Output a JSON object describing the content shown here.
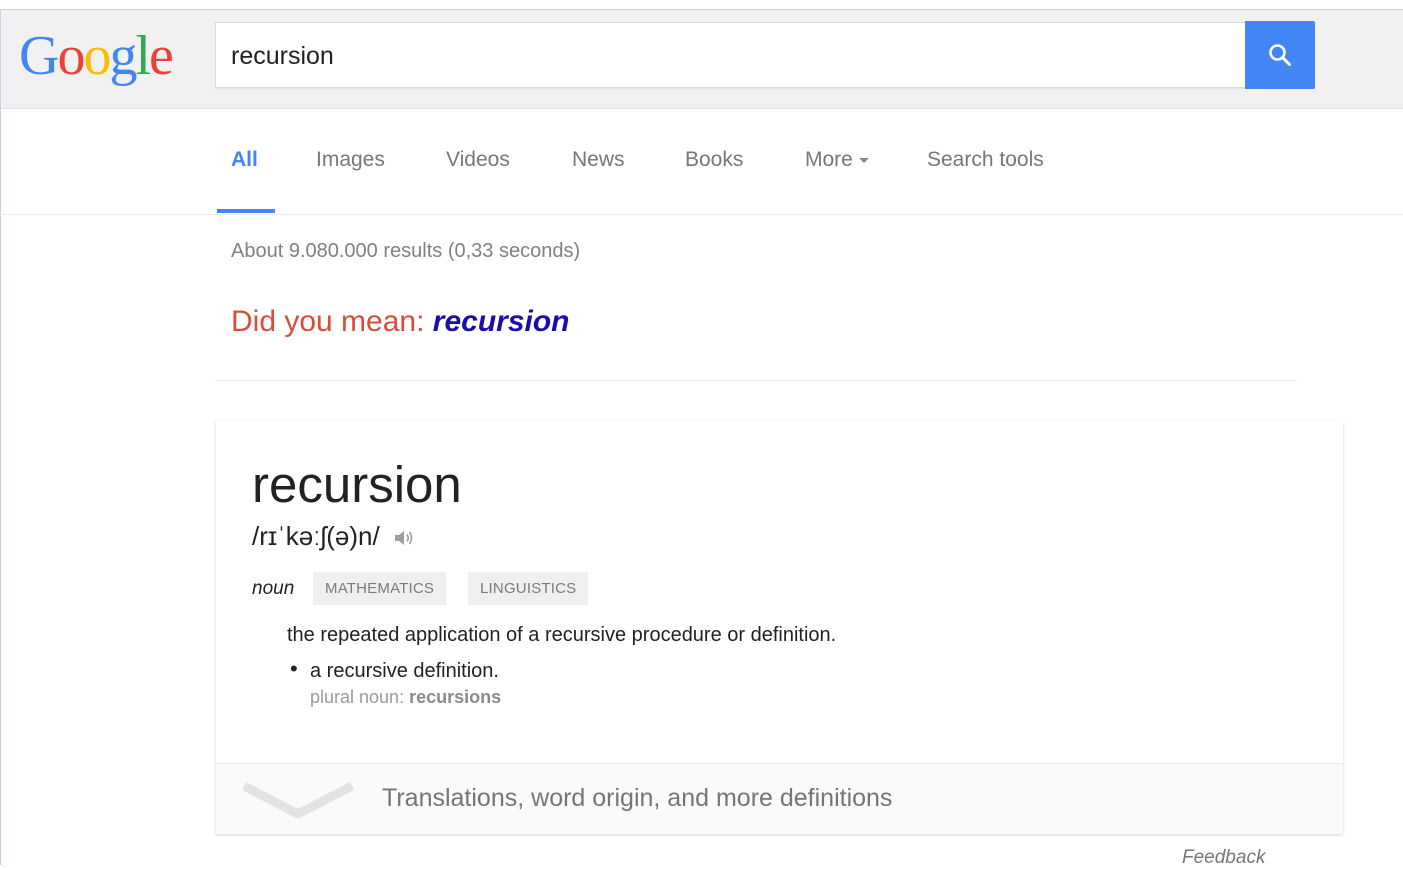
{
  "brand": {
    "logo_letters": [
      {
        "char": "G",
        "color": "#4285f4"
      },
      {
        "char": "o",
        "color": "#ea4335"
      },
      {
        "char": "o",
        "color": "#fbbc05"
      },
      {
        "char": "g",
        "color": "#4285f4"
      },
      {
        "char": "l",
        "color": "#34a853"
      },
      {
        "char": "e",
        "color": "#ea4335"
      }
    ]
  },
  "search": {
    "query": "recursion",
    "button_icon": "search-icon",
    "accent_color": "#4285f4"
  },
  "tabs": {
    "all": "All",
    "images": "Images",
    "videos": "Videos",
    "news": "News",
    "books": "Books",
    "more": "More",
    "search_tools": "Search tools"
  },
  "results": {
    "stats": "About 9.080.000 results (0,33 seconds)",
    "did_you_mean_label": "Did you mean:",
    "did_you_mean_term": "recursion"
  },
  "definition": {
    "word": "recursion",
    "phonetic": "/rɪˈkəːʃ(ə)n/",
    "audio_icon": "speaker-icon",
    "part_of_speech": "noun",
    "tags": [
      "MATHEMATICS",
      "LINGUISTICS"
    ],
    "meaning": "the repeated application of a recursive procedure or definition.",
    "sub_meaning": "a recursive definition.",
    "plural_label": "plural noun:",
    "plural_value": "recursions",
    "more_label": "Translations, word origin, and more definitions",
    "expand_icon": "chevron-down-icon"
  },
  "footer": {
    "feedback": "Feedback"
  }
}
